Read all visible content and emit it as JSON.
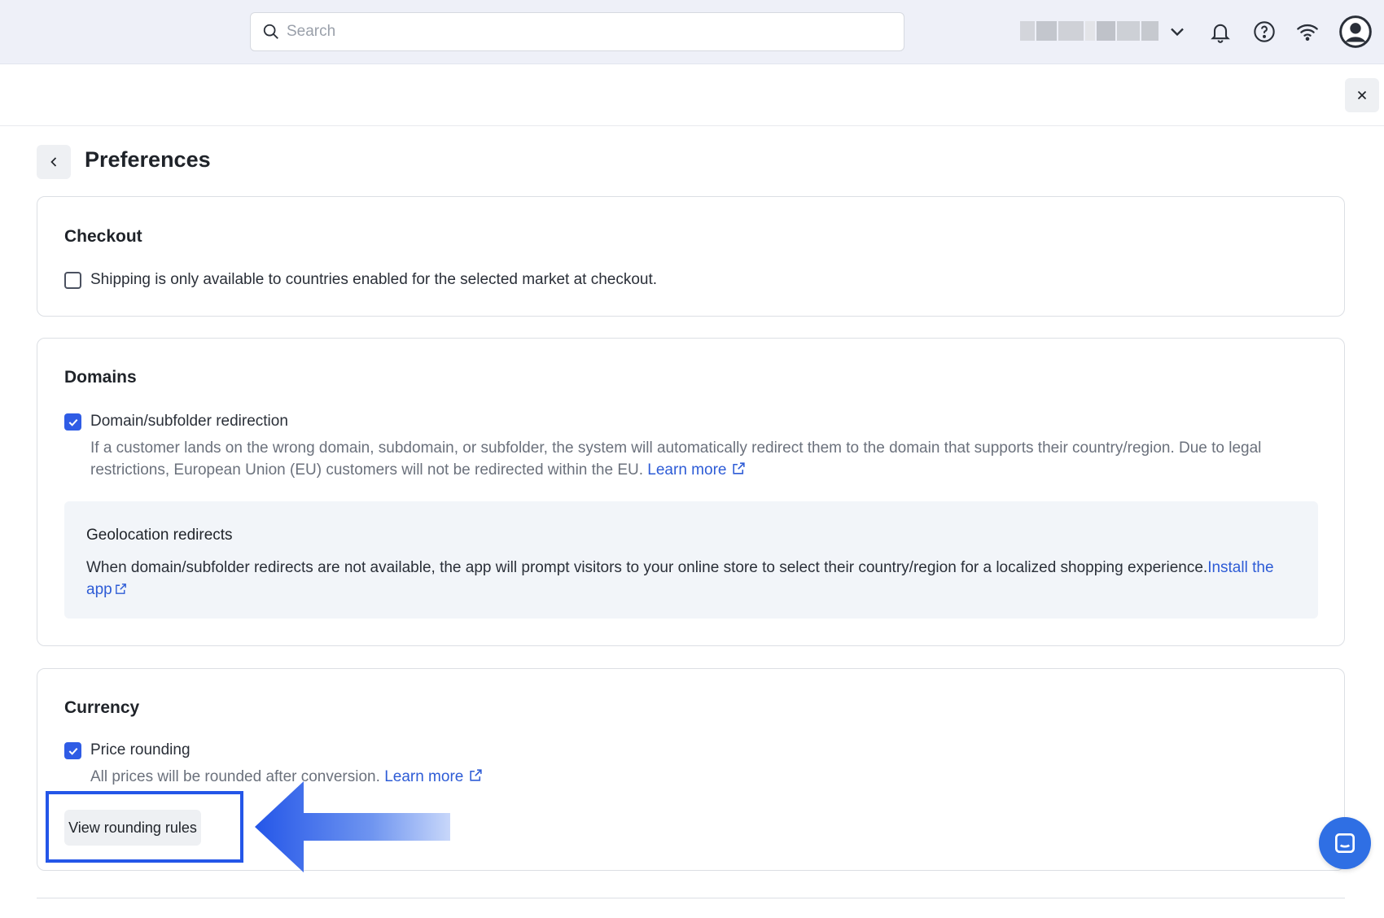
{
  "topbar": {
    "search_placeholder": "Search",
    "icons": [
      "search-icon",
      "chevron-down-icon",
      "bell-icon",
      "help-icon",
      "wifi-icon",
      "user-avatar-icon"
    ]
  },
  "page": {
    "title": "Preferences"
  },
  "checkout": {
    "title": "Checkout",
    "option_label": "Shipping is only available to countries enabled for the selected market at checkout.",
    "checked": false
  },
  "domains": {
    "title": "Domains",
    "option_label": "Domain/subfolder redirection",
    "checked": true,
    "description": "If a customer lands on the wrong domain, subdomain, or subfolder, the system will automatically redirect them to the domain that supports their country/region. Due to legal restrictions, European Union (EU) customers will not be redirected within the EU. ",
    "learn_more": "Learn more",
    "geo": {
      "title": "Geolocation redirects",
      "text": "When domain/subfolder redirects are not available, the app will prompt visitors to your online store to select their country/region for a localized shopping experience.",
      "install_link": "Install the app"
    }
  },
  "currency": {
    "title": "Currency",
    "option_label": "Price rounding",
    "checked": true,
    "description": "All prices will be rounded after conversion. ",
    "learn_more": "Learn more",
    "button_label": "View rounding rules"
  },
  "colors": {
    "accent": "#2f5ce5",
    "link": "#2e5cd6",
    "highlight": "#2456e8"
  }
}
